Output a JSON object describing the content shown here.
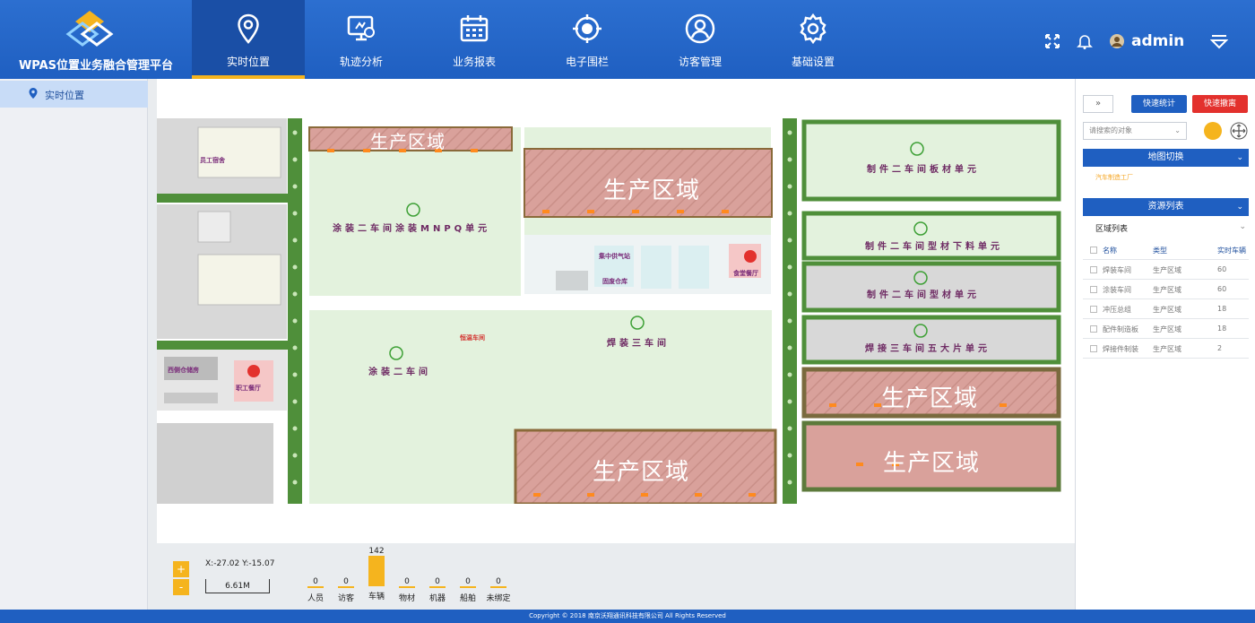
{
  "app": {
    "title": "WPAS位置业务融合管理平台"
  },
  "nav": {
    "items": [
      {
        "label": "实时位置",
        "icon": "location-pin-icon",
        "active": true
      },
      {
        "label": "轨迹分析",
        "icon": "monitor-analysis-icon",
        "active": false
      },
      {
        "label": "业务报表",
        "icon": "calendar-report-icon",
        "active": false
      },
      {
        "label": "电子围栏",
        "icon": "target-fence-icon",
        "active": false
      },
      {
        "label": "访客管理",
        "icon": "user-circle-icon",
        "active": false
      },
      {
        "label": "基础设置",
        "icon": "gear-icon",
        "active": false
      }
    ]
  },
  "header": {
    "user": "admin"
  },
  "sidebar": {
    "items": [
      {
        "label": "实时位置",
        "icon": "location-pin-icon"
      }
    ]
  },
  "map": {
    "zones": [
      "生产区域",
      "生产区域",
      "生产区域",
      "生产区域",
      "生产区域"
    ],
    "buildings": [
      "涂装二车间涂装MNPQ单元",
      "制件二车间板材单元",
      "制件二车间型材下料单元",
      "制件二车间型材单元",
      "焊接三车间五大片单元",
      "焊装三车间",
      "涂装二车间"
    ],
    "small_labels": [
      "集中供气站",
      "固废仓库",
      "恒温车间",
      "食堂餐厅",
      "员工宿舍",
      "西侧仓储房",
      "职工餐厅"
    ]
  },
  "bottom": {
    "coord_text": "X:-27.02 Y:-15.07",
    "scale_text": "6.61M",
    "zoom_in": "+",
    "zoom_out": "-",
    "stats": [
      {
        "label": "人员",
        "count": "0",
        "value": 0
      },
      {
        "label": "访客",
        "count": "0",
        "value": 0
      },
      {
        "label": "车辆",
        "count": "142",
        "value": 142
      },
      {
        "label": "物材",
        "count": "0",
        "value": 0
      },
      {
        "label": "机器",
        "count": "0",
        "value": 0
      },
      {
        "label": "船舶",
        "count": "0",
        "value": 0
      },
      {
        "label": "未绑定",
        "count": "0",
        "value": 0
      }
    ]
  },
  "right_panel": {
    "expand_label": "»",
    "quick_stats_label": "快速统计",
    "quick_evacuate_label": "快速撤离",
    "search_placeholder": "请搜索的对象",
    "map_switch_title": "地图切换",
    "map_switch_item": "汽车制造工厂",
    "resource_title": "资源列表",
    "area_list_label": "区域列表",
    "table_headers": [
      "名称",
      "类型",
      "实时车辆"
    ],
    "rows": [
      [
        "焊装车间",
        "生产区域",
        "60"
      ],
      [
        "涂装车间",
        "生产区域",
        "60"
      ],
      [
        "冲压总组",
        "生产区域",
        "18"
      ],
      [
        "配件制造板",
        "生产区域",
        "18"
      ],
      [
        "焊接件制装",
        "生产区域",
        "2"
      ]
    ]
  },
  "footer": {
    "text": "Copyright © 2018 南京沃翔通讯科技有限公司 All Rights Reserved"
  },
  "colors": {
    "primary": "#1f5fc1",
    "accent": "#f5b41e",
    "danger": "#e3312d",
    "zone": "#d9a19b",
    "green_area": "#e3f2dd",
    "hedge": "#4f8f3a"
  }
}
